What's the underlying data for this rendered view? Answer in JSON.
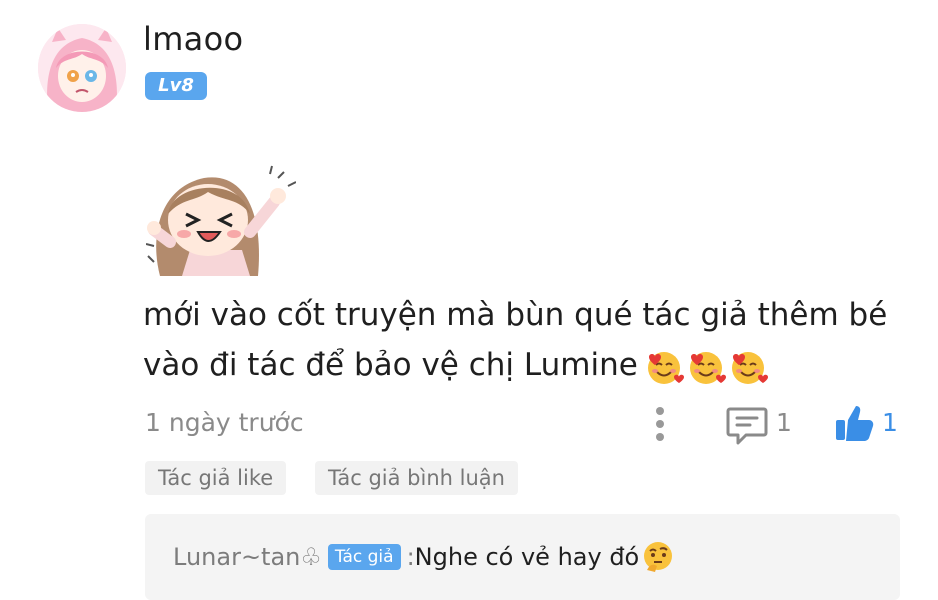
{
  "comment": {
    "username": "lmaoo",
    "level": "Lv8",
    "sticker": "chibi-girl-cheering-sticker",
    "text": "mới vào cốt truyện mà bùn qué tác giả thêm bé\nvào đi tác để bảo vệ chị Lumine",
    "emojis": [
      "smiling-face-with-hearts",
      "smiling-face-with-hearts",
      "smiling-face-with-hearts"
    ],
    "timestamp": "1 ngày trước",
    "reply_count": "1",
    "like_count": "1"
  },
  "tags": {
    "like": "Tác giả like",
    "reply": "Tác giả bình luận"
  },
  "reply": {
    "author": "Lunar~tan♧",
    "badge": "Tác giả",
    "separator": " : ",
    "text": "Nghe có vẻ hay đó",
    "emoji": "thinking-face"
  },
  "colors": {
    "accent": "#5aa6ee",
    "like_blue": "#3a8ee6",
    "muted": "#8a8a8a"
  }
}
